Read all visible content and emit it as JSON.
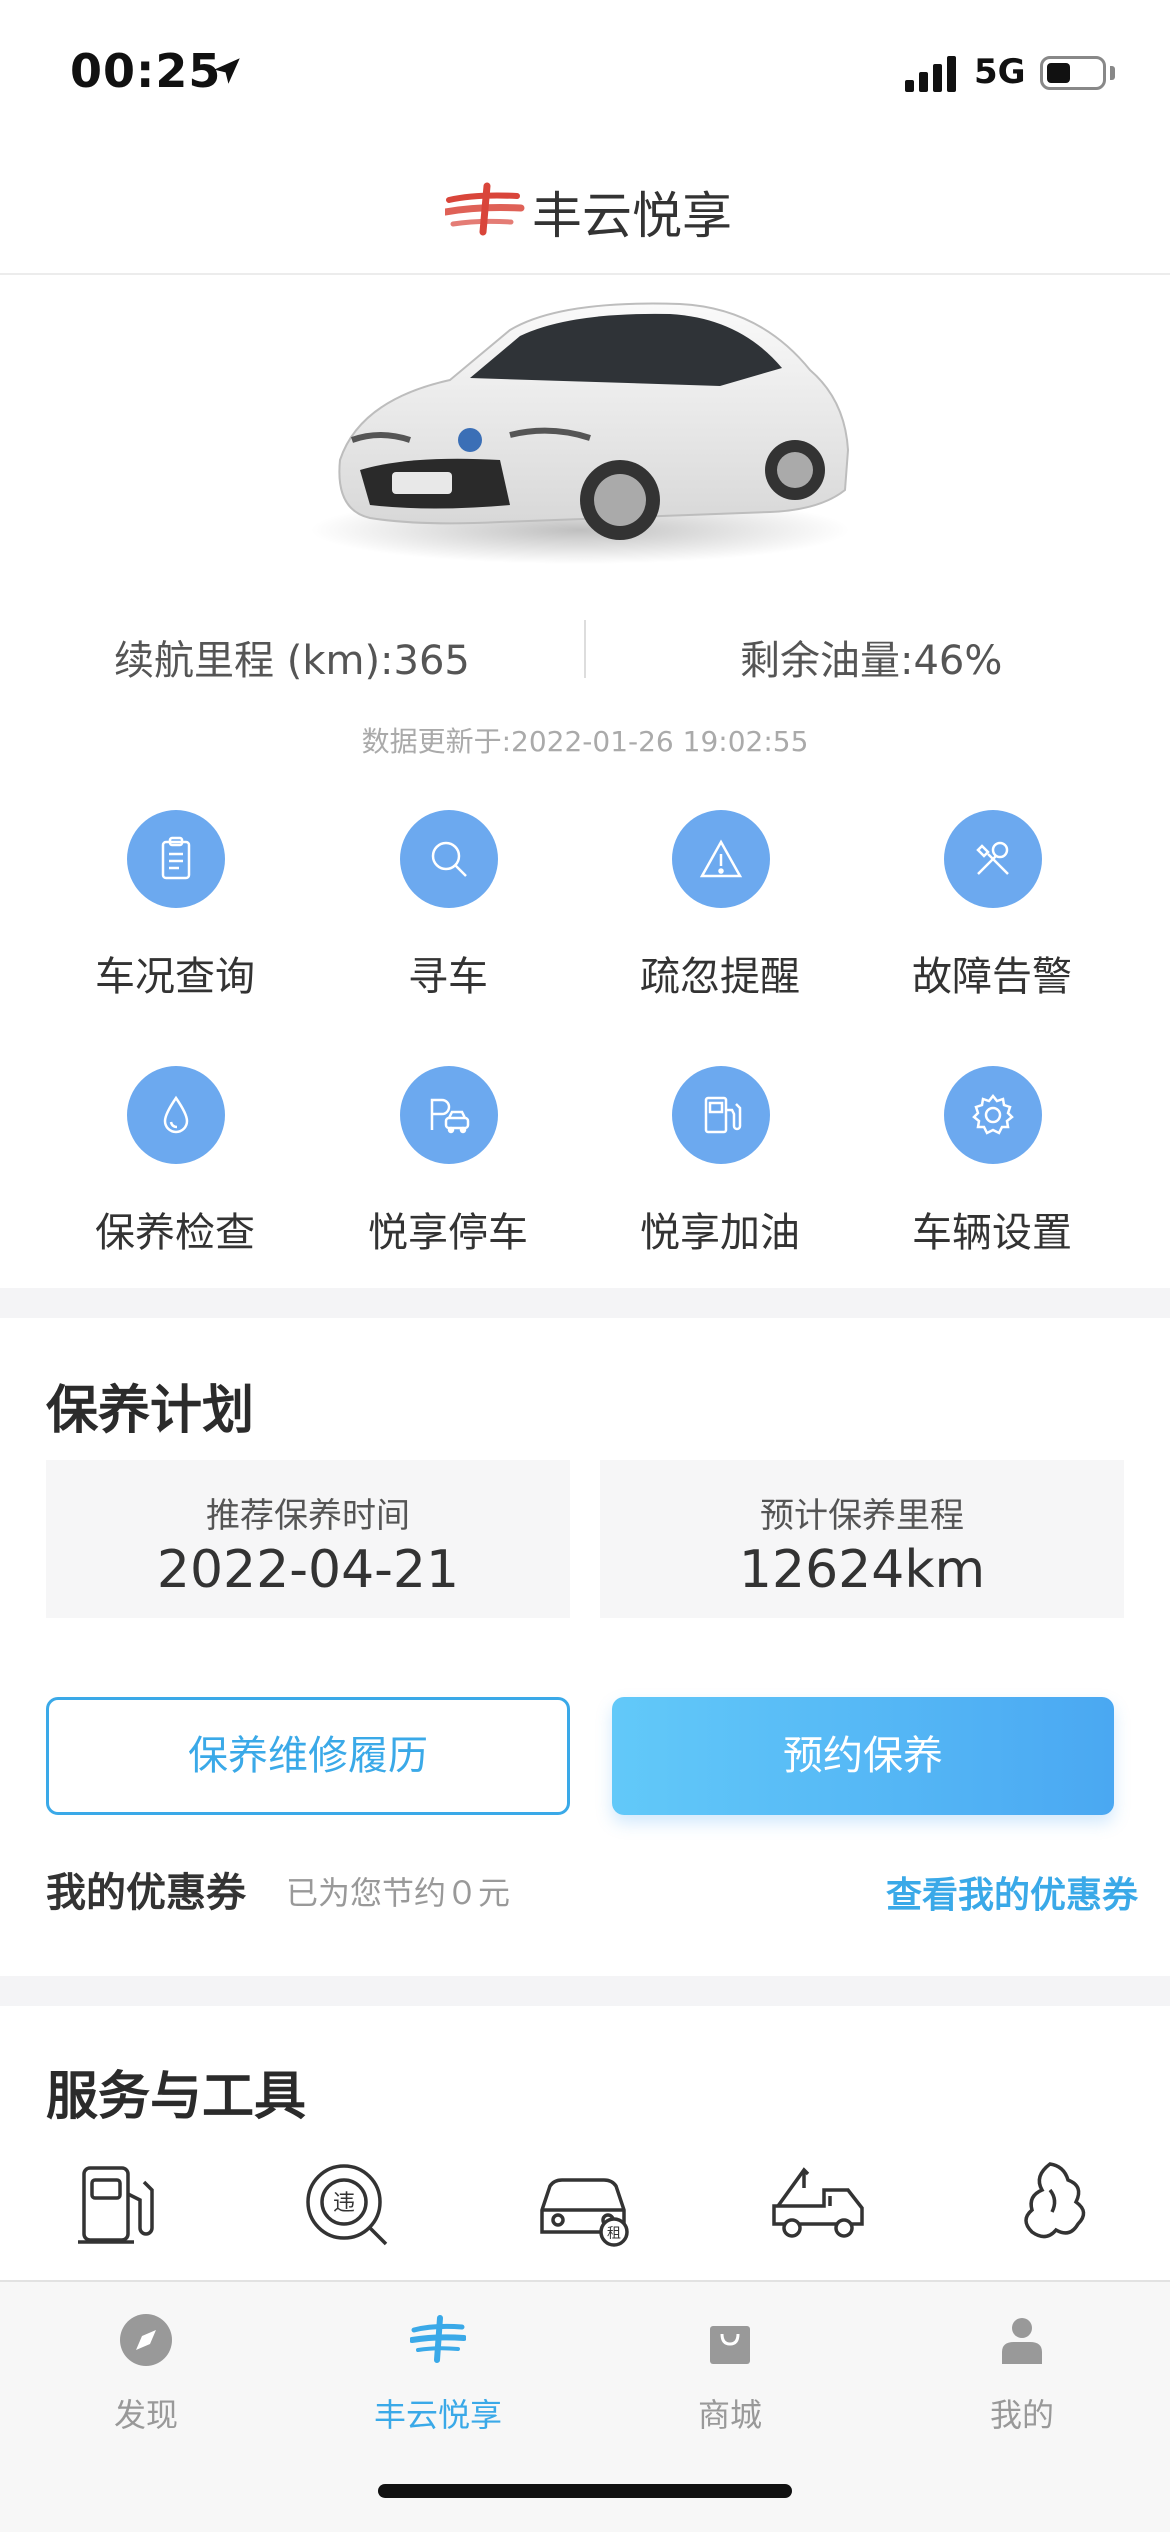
{
  "status_bar": {
    "time": "00:25",
    "network": "5G",
    "battery_level": 0.45
  },
  "header": {
    "title": "丰云悦享",
    "logo_icon": "fengyun-logo-icon",
    "brand_color": "#d9453a"
  },
  "vehicle": {
    "range_text": "续航里程 (km):365",
    "fuel_text": "剩余油量:46%",
    "update_text": "数据更新于:2022-01-26 19:02:55"
  },
  "grid": {
    "items": [
      {
        "label": "车况查询",
        "icon": "clipboard-icon"
      },
      {
        "label": "寻车",
        "icon": "search-icon"
      },
      {
        "label": "疏忽提醒",
        "icon": "warning-icon"
      },
      {
        "label": "故障告警",
        "icon": "tools-icon"
      },
      {
        "label": "保养检查",
        "icon": "drop-icon"
      },
      {
        "label": "悦享停车",
        "icon": "parking-icon"
      },
      {
        "label": "悦享加油",
        "icon": "fuel-pump-icon"
      },
      {
        "label": "车辆设置",
        "icon": "gear-icon"
      }
    ],
    "accent": "#6ca9ef"
  },
  "plan": {
    "title": "保养计划",
    "time_label": "推荐保养时间",
    "time_value": "2022-04-21",
    "mileage_label": "预计保养里程",
    "mileage_value": "12624km",
    "history_button": "保养维修履历",
    "book_button": "预约保养"
  },
  "coupon": {
    "title": "我的优惠券",
    "subtitle": "已为您节约０元",
    "link": "查看我的优惠券"
  },
  "services": {
    "title": "服务与工具",
    "tools": [
      "fuel-station-icon",
      "violation-search-icon",
      "car-rental-icon",
      "tow-truck-icon",
      "scenic-icon"
    ]
  },
  "tabs": [
    {
      "label": "发现",
      "icon": "compass-icon",
      "active": false
    },
    {
      "label": "丰云悦享",
      "icon": "fengyun-logo-icon",
      "active": true
    },
    {
      "label": "商城",
      "icon": "shopping-bag-icon",
      "active": false
    },
    {
      "label": "我的",
      "icon": "user-icon",
      "active": false
    }
  ]
}
